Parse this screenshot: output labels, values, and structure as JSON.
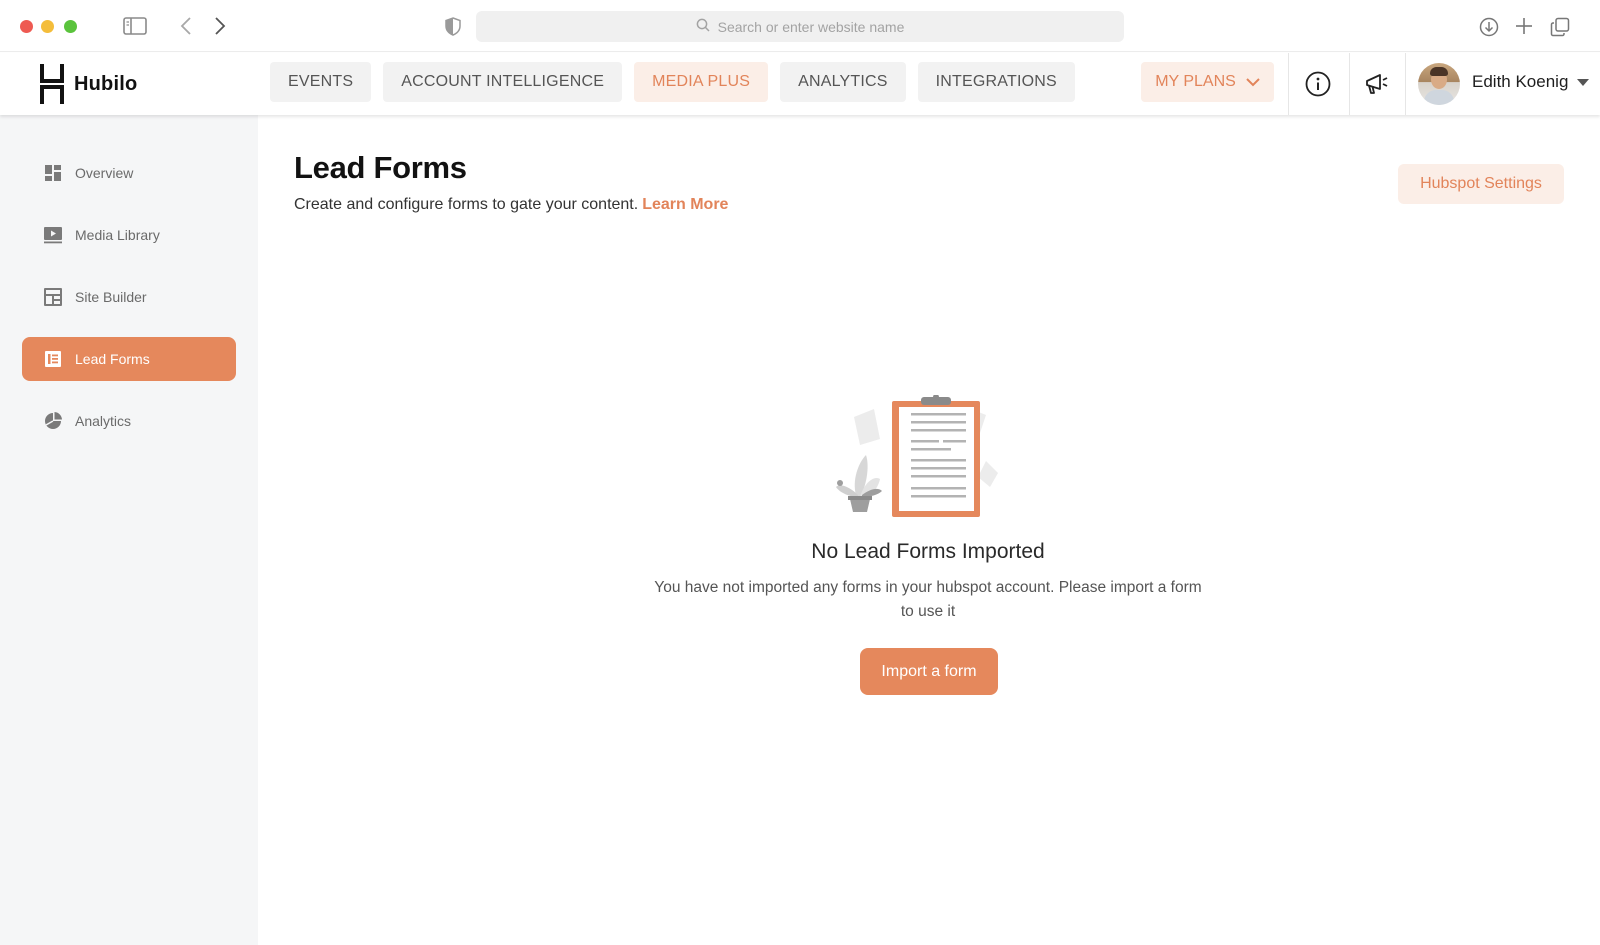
{
  "browser": {
    "url_placeholder": "Search or enter website name",
    "icons": [
      "sidebar-toggle-icon",
      "back-icon",
      "forward-icon",
      "shield-icon",
      "search-icon",
      "download-icon",
      "plus-icon",
      "tabs-icon"
    ]
  },
  "header": {
    "logo_text": "Hubilo",
    "nav": [
      {
        "label": "EVENTS"
      },
      {
        "label": "ACCOUNT INTELLIGENCE"
      },
      {
        "label": "MEDIA PLUS",
        "active": true
      },
      {
        "label": "ANALYTICS"
      },
      {
        "label": "INTEGRATIONS"
      }
    ],
    "my_plans": "MY PLANS",
    "user_name": "Edith Koenig"
  },
  "sidebar": {
    "items": [
      {
        "label": "Overview",
        "icon": "grid-icon"
      },
      {
        "label": "Media Library",
        "icon": "play-icon"
      },
      {
        "label": "Site Builder",
        "icon": "layout-icon"
      },
      {
        "label": "Lead Forms",
        "icon": "form-icon",
        "active": true
      },
      {
        "label": "Analytics",
        "icon": "pie-chart-icon"
      }
    ]
  },
  "main": {
    "title": "Lead Forms",
    "description": "Create and configure forms to gate your content.",
    "learn_more": "Learn More",
    "hubspot_button": "Hubspot Settings",
    "empty_title": "No Lead Forms Imported",
    "empty_description": "You have not imported any forms in your hubspot account. Please import a form to use it",
    "import_button": "Import a form"
  },
  "colors": {
    "accent": "#e5885c",
    "accent_light": "#fbeee7",
    "sidebar_bg": "#f5f6f7"
  }
}
